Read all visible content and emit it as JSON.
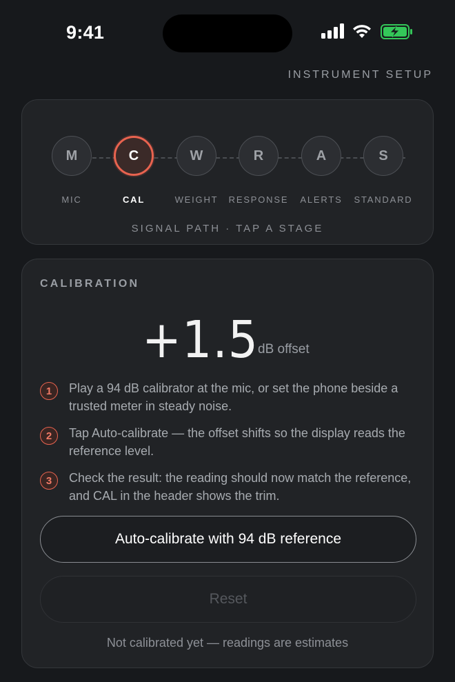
{
  "status_bar": {
    "time": "9:41"
  },
  "header": {
    "section_label": "INSTRUMENT SETUP"
  },
  "signal_path": {
    "stages": [
      {
        "letter": "M",
        "label": "MIC",
        "active": false
      },
      {
        "letter": "C",
        "label": "CAL",
        "active": true
      },
      {
        "letter": "W",
        "label": "WEIGHT",
        "active": false
      },
      {
        "letter": "R",
        "label": "RESPONSE",
        "active": false
      },
      {
        "letter": "A",
        "label": "ALERTS",
        "active": false
      },
      {
        "letter": "S",
        "label": "STANDARD",
        "active": false
      }
    ],
    "hint": "SIGNAL PATH · TAP A STAGE"
  },
  "calibration": {
    "title": "CALIBRATION",
    "offset_value": "+1.5",
    "offset_unit": "dB offset",
    "steps": [
      {
        "num": "1",
        "text": "Play a 94 dB calibrator at the mic, or set the phone beside a trusted meter in steady noise."
      },
      {
        "num": "2",
        "text": "Tap Auto-calibrate — the offset shifts so the display reads the reference level."
      },
      {
        "num": "3",
        "text": "Check the result: the reading should now match the reference, and CAL in the header shows the trim."
      }
    ],
    "auto_button": "Auto-calibrate with 94 dB reference",
    "reset_button": "Reset",
    "note": "Not calibrated yet — readings are estimates"
  },
  "colors": {
    "accent": "#e8634f",
    "background": "#17191c",
    "card": "#212326"
  }
}
